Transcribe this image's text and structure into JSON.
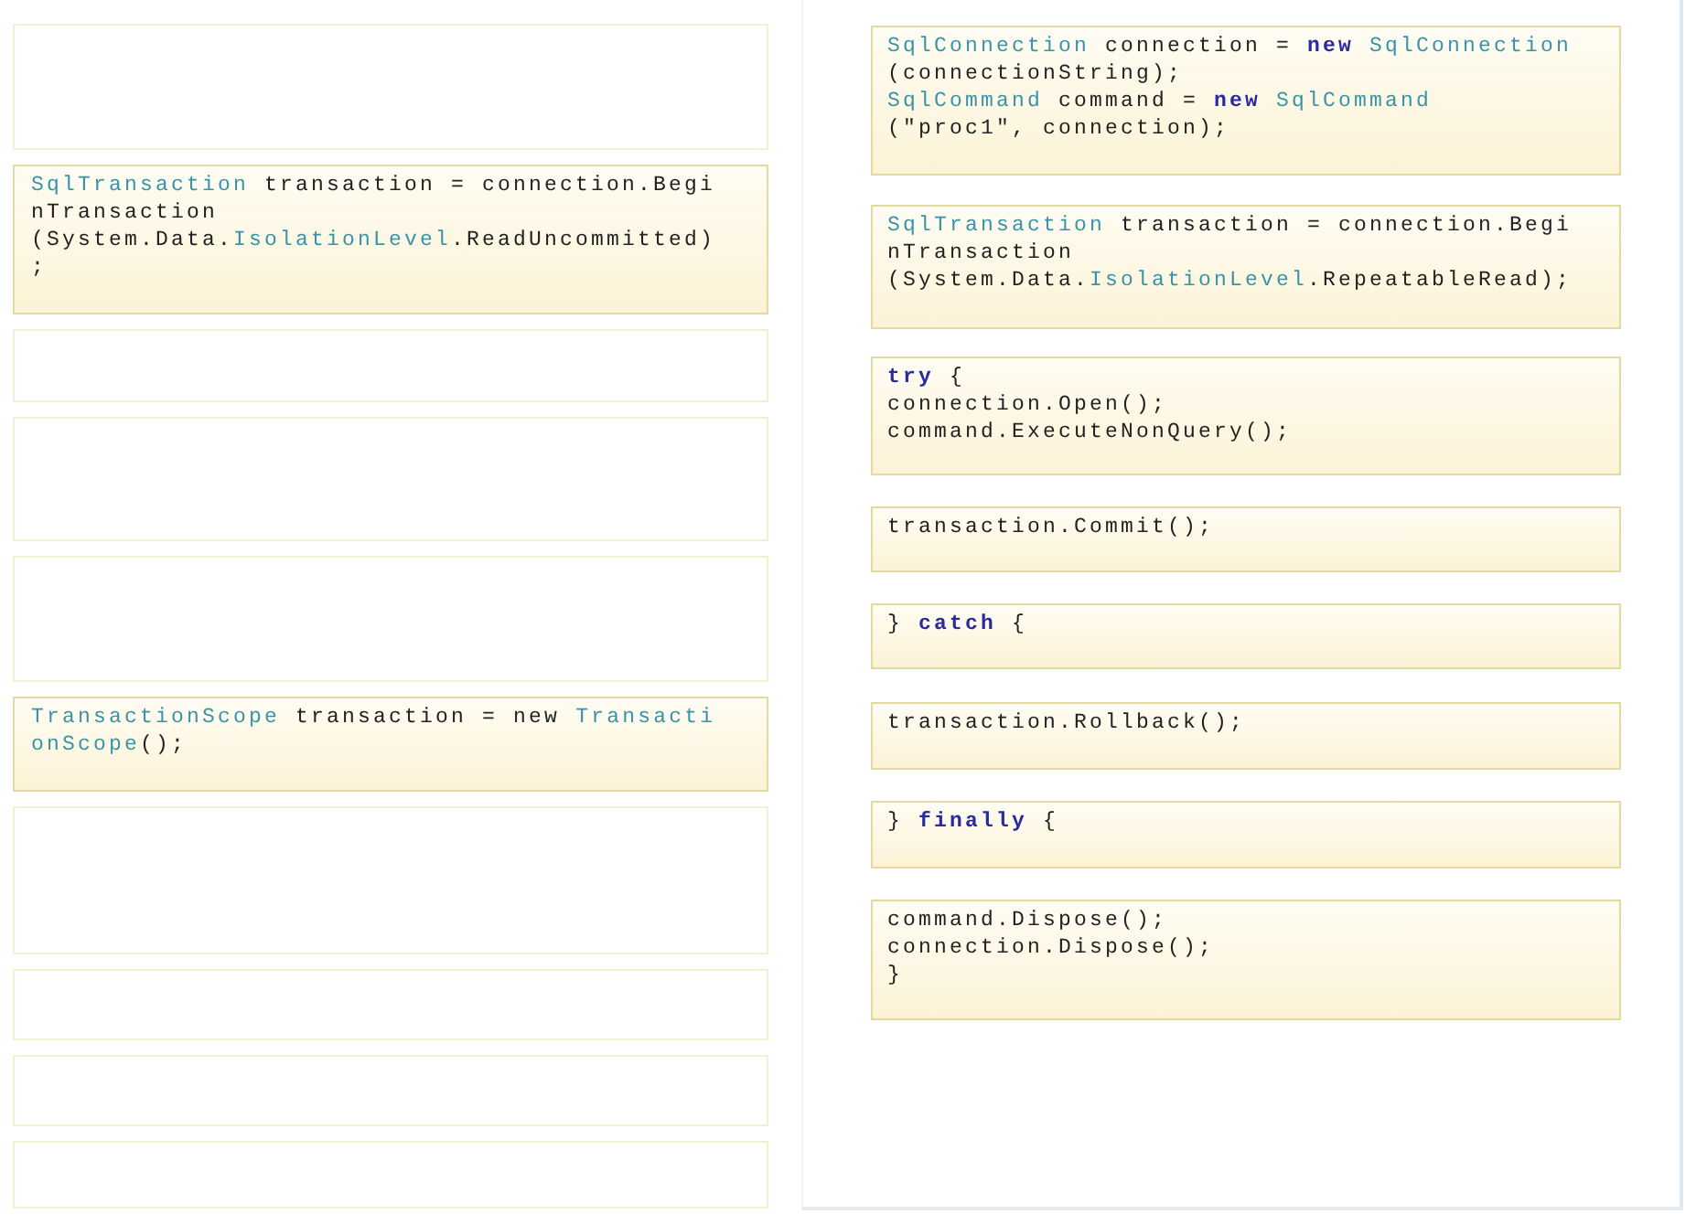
{
  "answer_slots": [
    {
      "kind": "empty"
    },
    {
      "kind": "code",
      "lines": [
        [
          {
            "text": "SqlTransaction",
            "kind": "type"
          },
          {
            "text": " transaction = connection.Begi",
            "kind": "plain"
          }
        ],
        [
          {
            "text": "nTransaction",
            "kind": "plain"
          }
        ],
        [
          {
            "text": "(System.Data.",
            "kind": "plain"
          },
          {
            "text": "IsolationLevel",
            "kind": "type"
          },
          {
            "text": ".ReadUncommitted)",
            "kind": "plain"
          }
        ],
        [
          {
            "text": ";",
            "kind": "plain"
          }
        ]
      ]
    },
    {
      "kind": "empty"
    },
    {
      "kind": "empty"
    },
    {
      "kind": "empty"
    },
    {
      "kind": "code",
      "lines": [
        [
          {
            "text": "TransactionScope",
            "kind": "type"
          },
          {
            "text": " transaction = new ",
            "kind": "plain"
          },
          {
            "text": "Transacti",
            "kind": "type"
          }
        ],
        [
          {
            "text": "onScope",
            "kind": "type"
          },
          {
            "text": "();",
            "kind": "plain"
          }
        ]
      ]
    },
    {
      "kind": "empty"
    },
    {
      "kind": "empty"
    },
    {
      "kind": "empty"
    },
    {
      "kind": "empty"
    }
  ],
  "code_segments": [
    {
      "lines": [
        [
          {
            "text": "SqlConnection",
            "kind": "type"
          },
          {
            "text": " connection = ",
            "kind": "plain"
          },
          {
            "text": "new",
            "kind": "keyword"
          },
          {
            "text": " SqlConnection",
            "kind": "type"
          }
        ],
        [
          {
            "text": "(connectionString);",
            "kind": "plain"
          }
        ],
        [
          {
            "text": "SqlCommand",
            "kind": "type"
          },
          {
            "text": " command = ",
            "kind": "plain"
          },
          {
            "text": "new",
            "kind": "keyword"
          },
          {
            "text": " SqlCommand",
            "kind": "type"
          }
        ],
        [
          {
            "text": "(\"proc1\", connection);",
            "kind": "plain"
          }
        ]
      ]
    },
    {
      "lines": [
        [
          {
            "text": "SqlTransaction",
            "kind": "type"
          },
          {
            "text": " transaction = connection.Begi",
            "kind": "plain"
          }
        ],
        [
          {
            "text": "nTransaction",
            "kind": "plain"
          }
        ],
        [
          {
            "text": "(System.Data.",
            "kind": "plain"
          },
          {
            "text": "IsolationLevel",
            "kind": "type"
          },
          {
            "text": ".RepeatableRead);",
            "kind": "plain"
          }
        ]
      ]
    },
    {
      "lines": [
        [
          {
            "text": "try",
            "kind": "keyword"
          },
          {
            "text": " {",
            "kind": "plain"
          }
        ],
        [
          {
            "text": "connection.Open();",
            "kind": "plain"
          }
        ],
        [
          {
            "text": "command.ExecuteNonQuery();",
            "kind": "plain"
          }
        ]
      ]
    },
    {
      "lines": [
        [
          {
            "text": "transaction.Commit();",
            "kind": "plain"
          }
        ]
      ]
    },
    {
      "lines": [
        [
          {
            "text": "} ",
            "kind": "plain"
          },
          {
            "text": "catch",
            "kind": "keyword"
          },
          {
            "text": " {",
            "kind": "plain"
          }
        ]
      ]
    },
    {
      "lines": [
        [
          {
            "text": "transaction.Rollback();",
            "kind": "plain"
          }
        ]
      ]
    },
    {
      "lines": [
        [
          {
            "text": "} ",
            "kind": "plain"
          },
          {
            "text": "finally",
            "kind": "keyword"
          },
          {
            "text": " {",
            "kind": "plain"
          }
        ]
      ]
    },
    {
      "lines": [
        [
          {
            "text": "command.Dispose();",
            "kind": "plain"
          }
        ],
        [
          {
            "text": "connection.Dispose();",
            "kind": "plain"
          }
        ],
        [
          {
            "text": "}",
            "kind": "plain"
          }
        ]
      ]
    }
  ]
}
